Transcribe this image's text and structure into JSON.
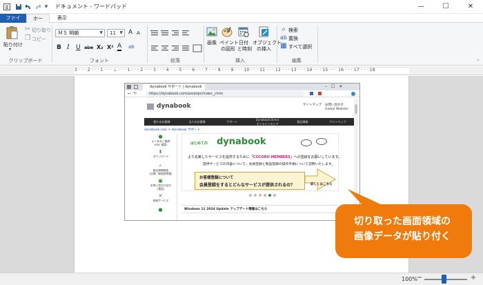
{
  "window": {
    "title": "ドキュメント - ワードパッド",
    "minimize_glyph": "—",
    "maximize_glyph": "☐",
    "close_glyph": "✕"
  },
  "quick_access": {
    "save_icon": "save-icon",
    "undo_icon": "undo-icon",
    "redo_icon": "redo-icon",
    "customize_glyph": "▾"
  },
  "tabs": {
    "file": "ファイル",
    "home": "ホーム",
    "view": "表示"
  },
  "ribbon": {
    "clipboard": {
      "paste": "貼り付け",
      "paste_arrow": "▾",
      "cut": "切り取り",
      "copy": "コピー",
      "group": "クリップボード"
    },
    "font": {
      "name": "ＭＳ 明朝",
      "size": "11",
      "grow": "A",
      "shrink": "A",
      "bold": "B",
      "italic": "I",
      "underline": "U",
      "strike": "abe",
      "subscript": "X₂",
      "superscript": "X²",
      "font_color": "A",
      "highlight": "ab",
      "group": "フォント"
    },
    "paragraph": {
      "group": "段落"
    },
    "insert": {
      "picture": "画像",
      "paint_l1": "ペイント",
      "paint_l2": "の図形",
      "datetime_l1": "日付",
      "datetime_l2": "と時刻",
      "object_l1": "オブジェクト",
      "object_l2": "の挿入",
      "group": "挿入"
    },
    "edit": {
      "find": "検索",
      "replace": "置換",
      "select_all": "すべて選択",
      "group": "編集"
    }
  },
  "ruler": {
    "text": "3 · · · 2 · · · 1 · · · ⊥ · · · 1 · · · 2 · · · 3 · · · 4 · · · 5 · · · 6 · · · 7 · · · 8 · · · 9 · · · 10 · · · 11 · · · 12 · · · 13 · · · 14 · · · 15 · · · 16 · · · 17 · · · 18"
  },
  "pasted_image": {
    "browser_tab": "dynabook サポート | dynabook",
    "url": "https://dynabook.com/assistpc/index_j.htm",
    "site_logo": "dynabook",
    "top_links": [
      "サイトマップ",
      "お問い合わせ",
      "Global Website"
    ],
    "nav": [
      "個人のお客様",
      "法人のお客様",
      "サポート",
      "Dynabook Direct\nオンラインストア",
      "製品情報",
      "サイトマップ"
    ],
    "breadcrumb": "dynabook.com > dynabook サポート",
    "side_menu": [
      {
        "label": "よくあるご質問\n(FAQ 検索)",
        "icon": "chat-icon"
      },
      {
        "label": "ダウンロード",
        "icon": "download-icon"
      },
      {
        "label": "製品情報検索\n(仕様／取扱説明書)",
        "icon": "search-icon"
      },
      {
        "label": "お問い合わせ窓口\n(電話)",
        "icon": "phone-icon"
      },
      {
        "label": "修理サービス",
        "icon": "wrench-icon"
      },
      {
        "label": "",
        "icon": "globe-icon"
      }
    ],
    "banner": {
      "prefix": "はじめての",
      "title": "dynabook",
      "line1_a": "より充実したサービスを提供するために",
      "line1_accent": "「COCORO MEMBERS」",
      "line1_b": "への登録をお願いしています。",
      "line2": "提供サービスの内容について、会員登録と製品登録の操作手順について説明いたします。",
      "callout_1": "お客様登録について",
      "callout_2": "会員登録をするとどんなサービスが提供されるの？",
      "more": "詳しくはこちら"
    },
    "news": "Windows 11 2024 Update アップデート情報はこちら"
  },
  "callout": {
    "line1": "切り取った画面領域の",
    "line2": "画像データが貼り付く"
  },
  "status": {
    "zoom": "100%",
    "zoom_minus": "−",
    "zoom_plus": "+",
    "zoom_level": 0.5
  },
  "colors": {
    "accent": "#1e5fb3",
    "callout_orange": "#f07a0c",
    "site_green": "#2e8b3a"
  }
}
